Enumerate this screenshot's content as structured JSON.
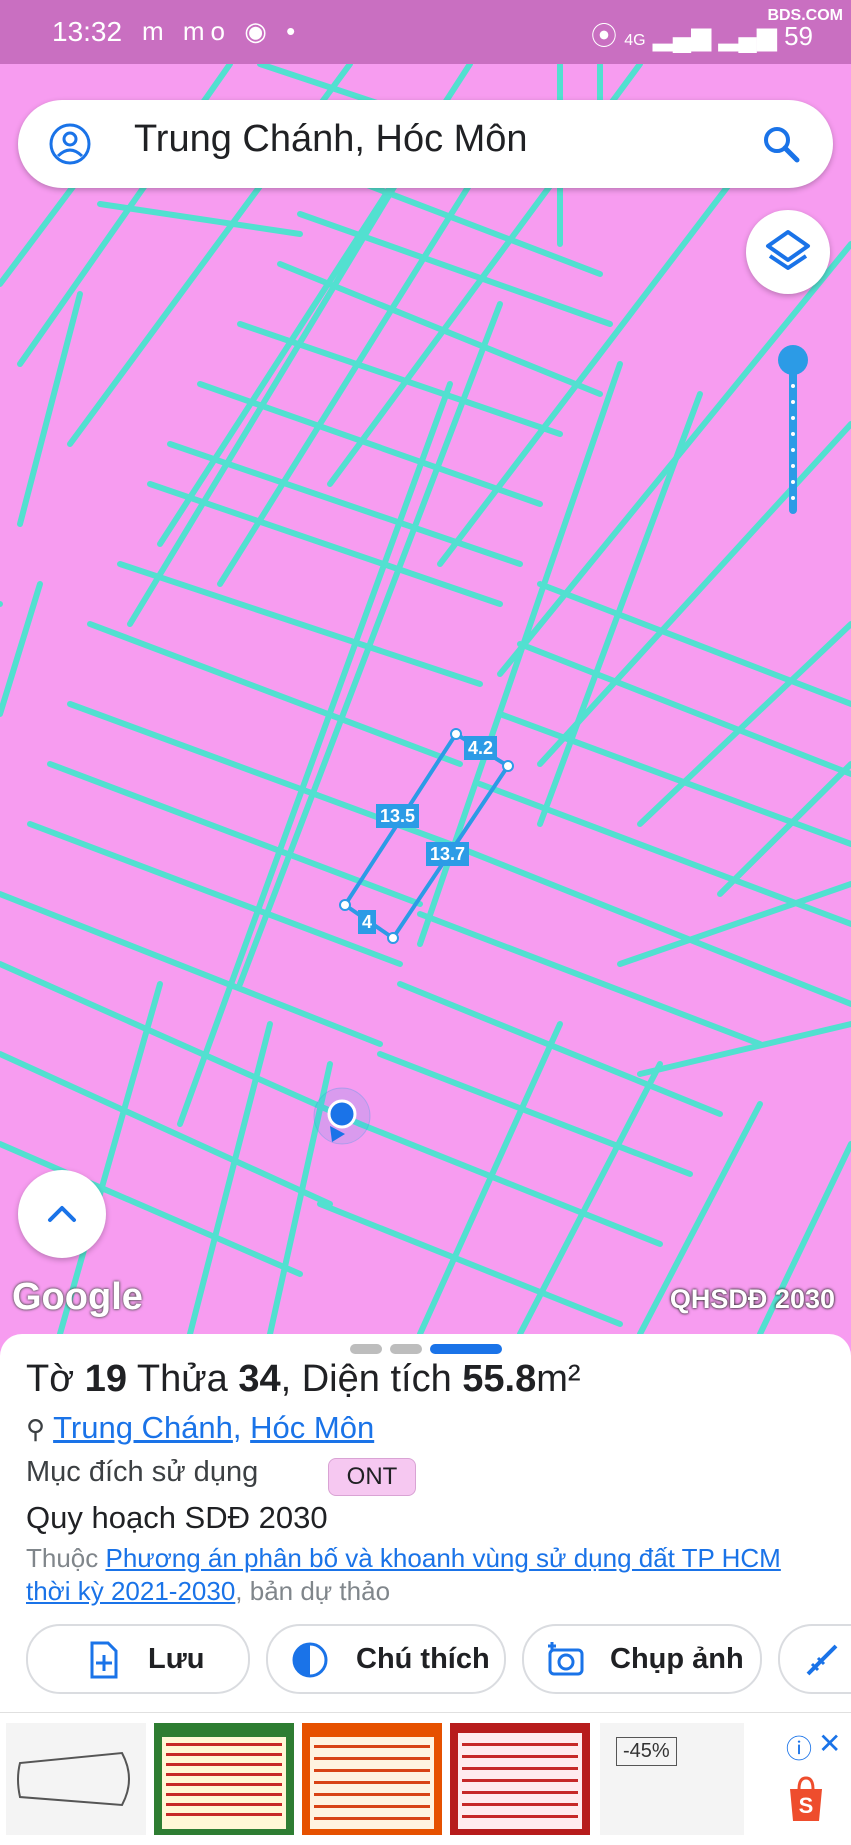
{
  "status": {
    "time": "13:32",
    "apps": "m mo ◉ •",
    "network": "4G",
    "battery": "59",
    "watermark": "BDS.COM"
  },
  "search": {
    "query": "Trung Chánh, Hóc Môn"
  },
  "map": {
    "measurements": [
      "4.2",
      "13.5",
      "13.7",
      "4"
    ],
    "attribution": "Google",
    "layer_label": "QHSDĐ 2030"
  },
  "parcel": {
    "title_prefix": "Tờ ",
    "sheet": "19",
    "title_mid": " Thửa ",
    "plot": "34",
    "title_area_label": ", Diện tích ",
    "area": "55.8",
    "area_unit": "m²",
    "ward": "Trung Chánh",
    "sep": ", ",
    "district": "Hóc Môn",
    "purpose_label": "Mục đích sử dụng",
    "purpose_code": "ONT",
    "plan_title": "Quy hoạch SDĐ 2030",
    "belong_prefix": "Thuộc ",
    "belong_link": "Phương án phân bố và khoanh vùng sử dụng đất TP HCM thời kỳ 2021-2030",
    "belong_suffix": ", bản dự thảo"
  },
  "actions": [
    {
      "label": "Lưu",
      "icon": "add-file-icon"
    },
    {
      "label": "Chú thích",
      "icon": "contrast-icon"
    },
    {
      "label": "Chụp ảnh",
      "icon": "camera-icon"
    },
    {
      "label": "",
      "icon": "measure-icon"
    }
  ],
  "ad": {
    "discount": "-45%"
  },
  "colors": {
    "map_bg": "#f79cf0",
    "parcel_line": "#52e0d0",
    "accent": "#1a73e8",
    "measure": "#2c9be6"
  }
}
